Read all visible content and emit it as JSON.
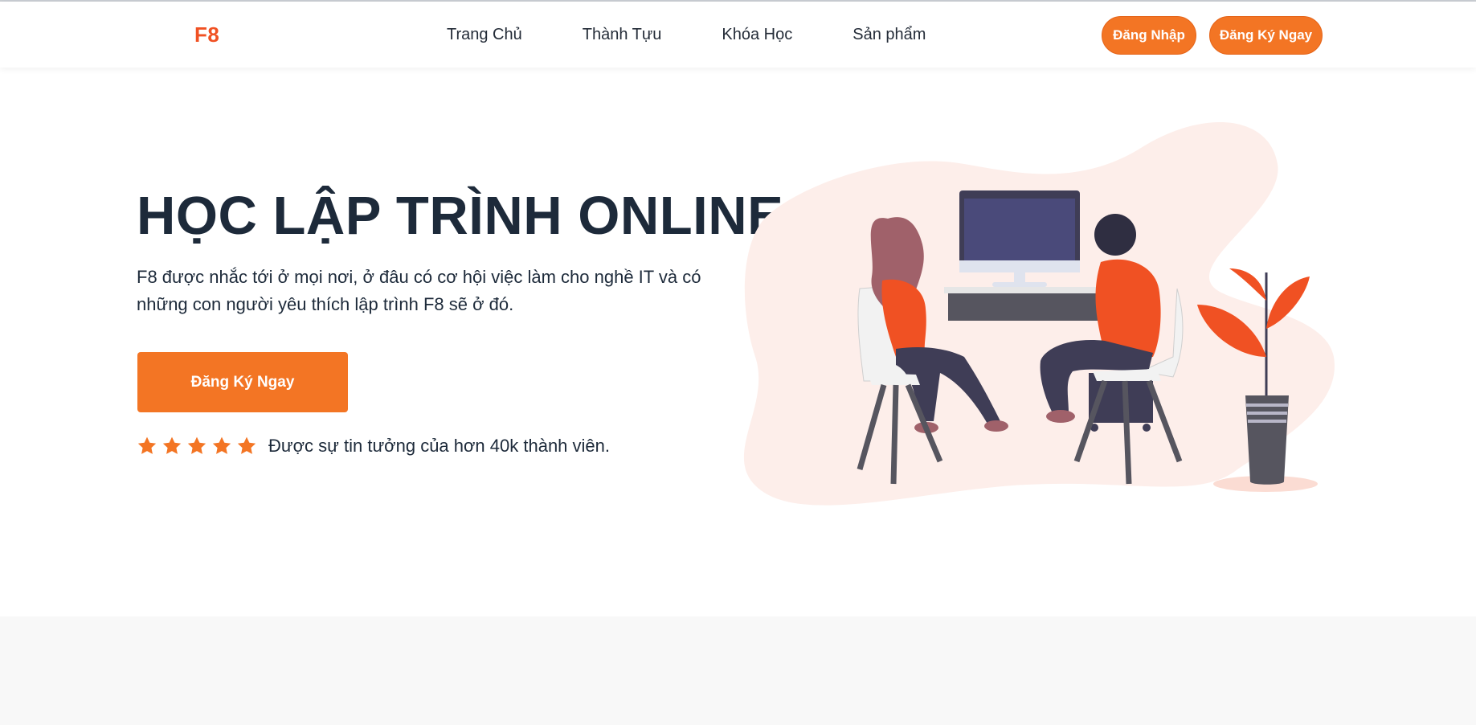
{
  "header": {
    "logo": "F8",
    "nav": [
      {
        "label": "Trang Chủ"
      },
      {
        "label": "Thành Tựu"
      },
      {
        "label": "Khóa Học"
      },
      {
        "label": "Sản phẩm"
      }
    ],
    "login_label": "Đăng Nhập",
    "register_label": "Đăng Ký Ngay"
  },
  "hero": {
    "title": "HỌC LẬP TRÌNH ONLINE",
    "description": "F8 được nhắc tới ở mọi nơi, ở đâu có cơ hội việc làm cho nghề IT và có những con người yêu thích lập trình F8 sẽ ở đó.",
    "cta_label": "Đăng Ký Ngay",
    "rating": {
      "stars": 5,
      "text": "Được sự tin tưởng của hơn 40k thành viên."
    }
  },
  "colors": {
    "accent": "#f37524",
    "logo": "#f05123",
    "heading": "#1d2a3a",
    "blob": "#fdeeea"
  },
  "icons": [
    "star-icon"
  ]
}
